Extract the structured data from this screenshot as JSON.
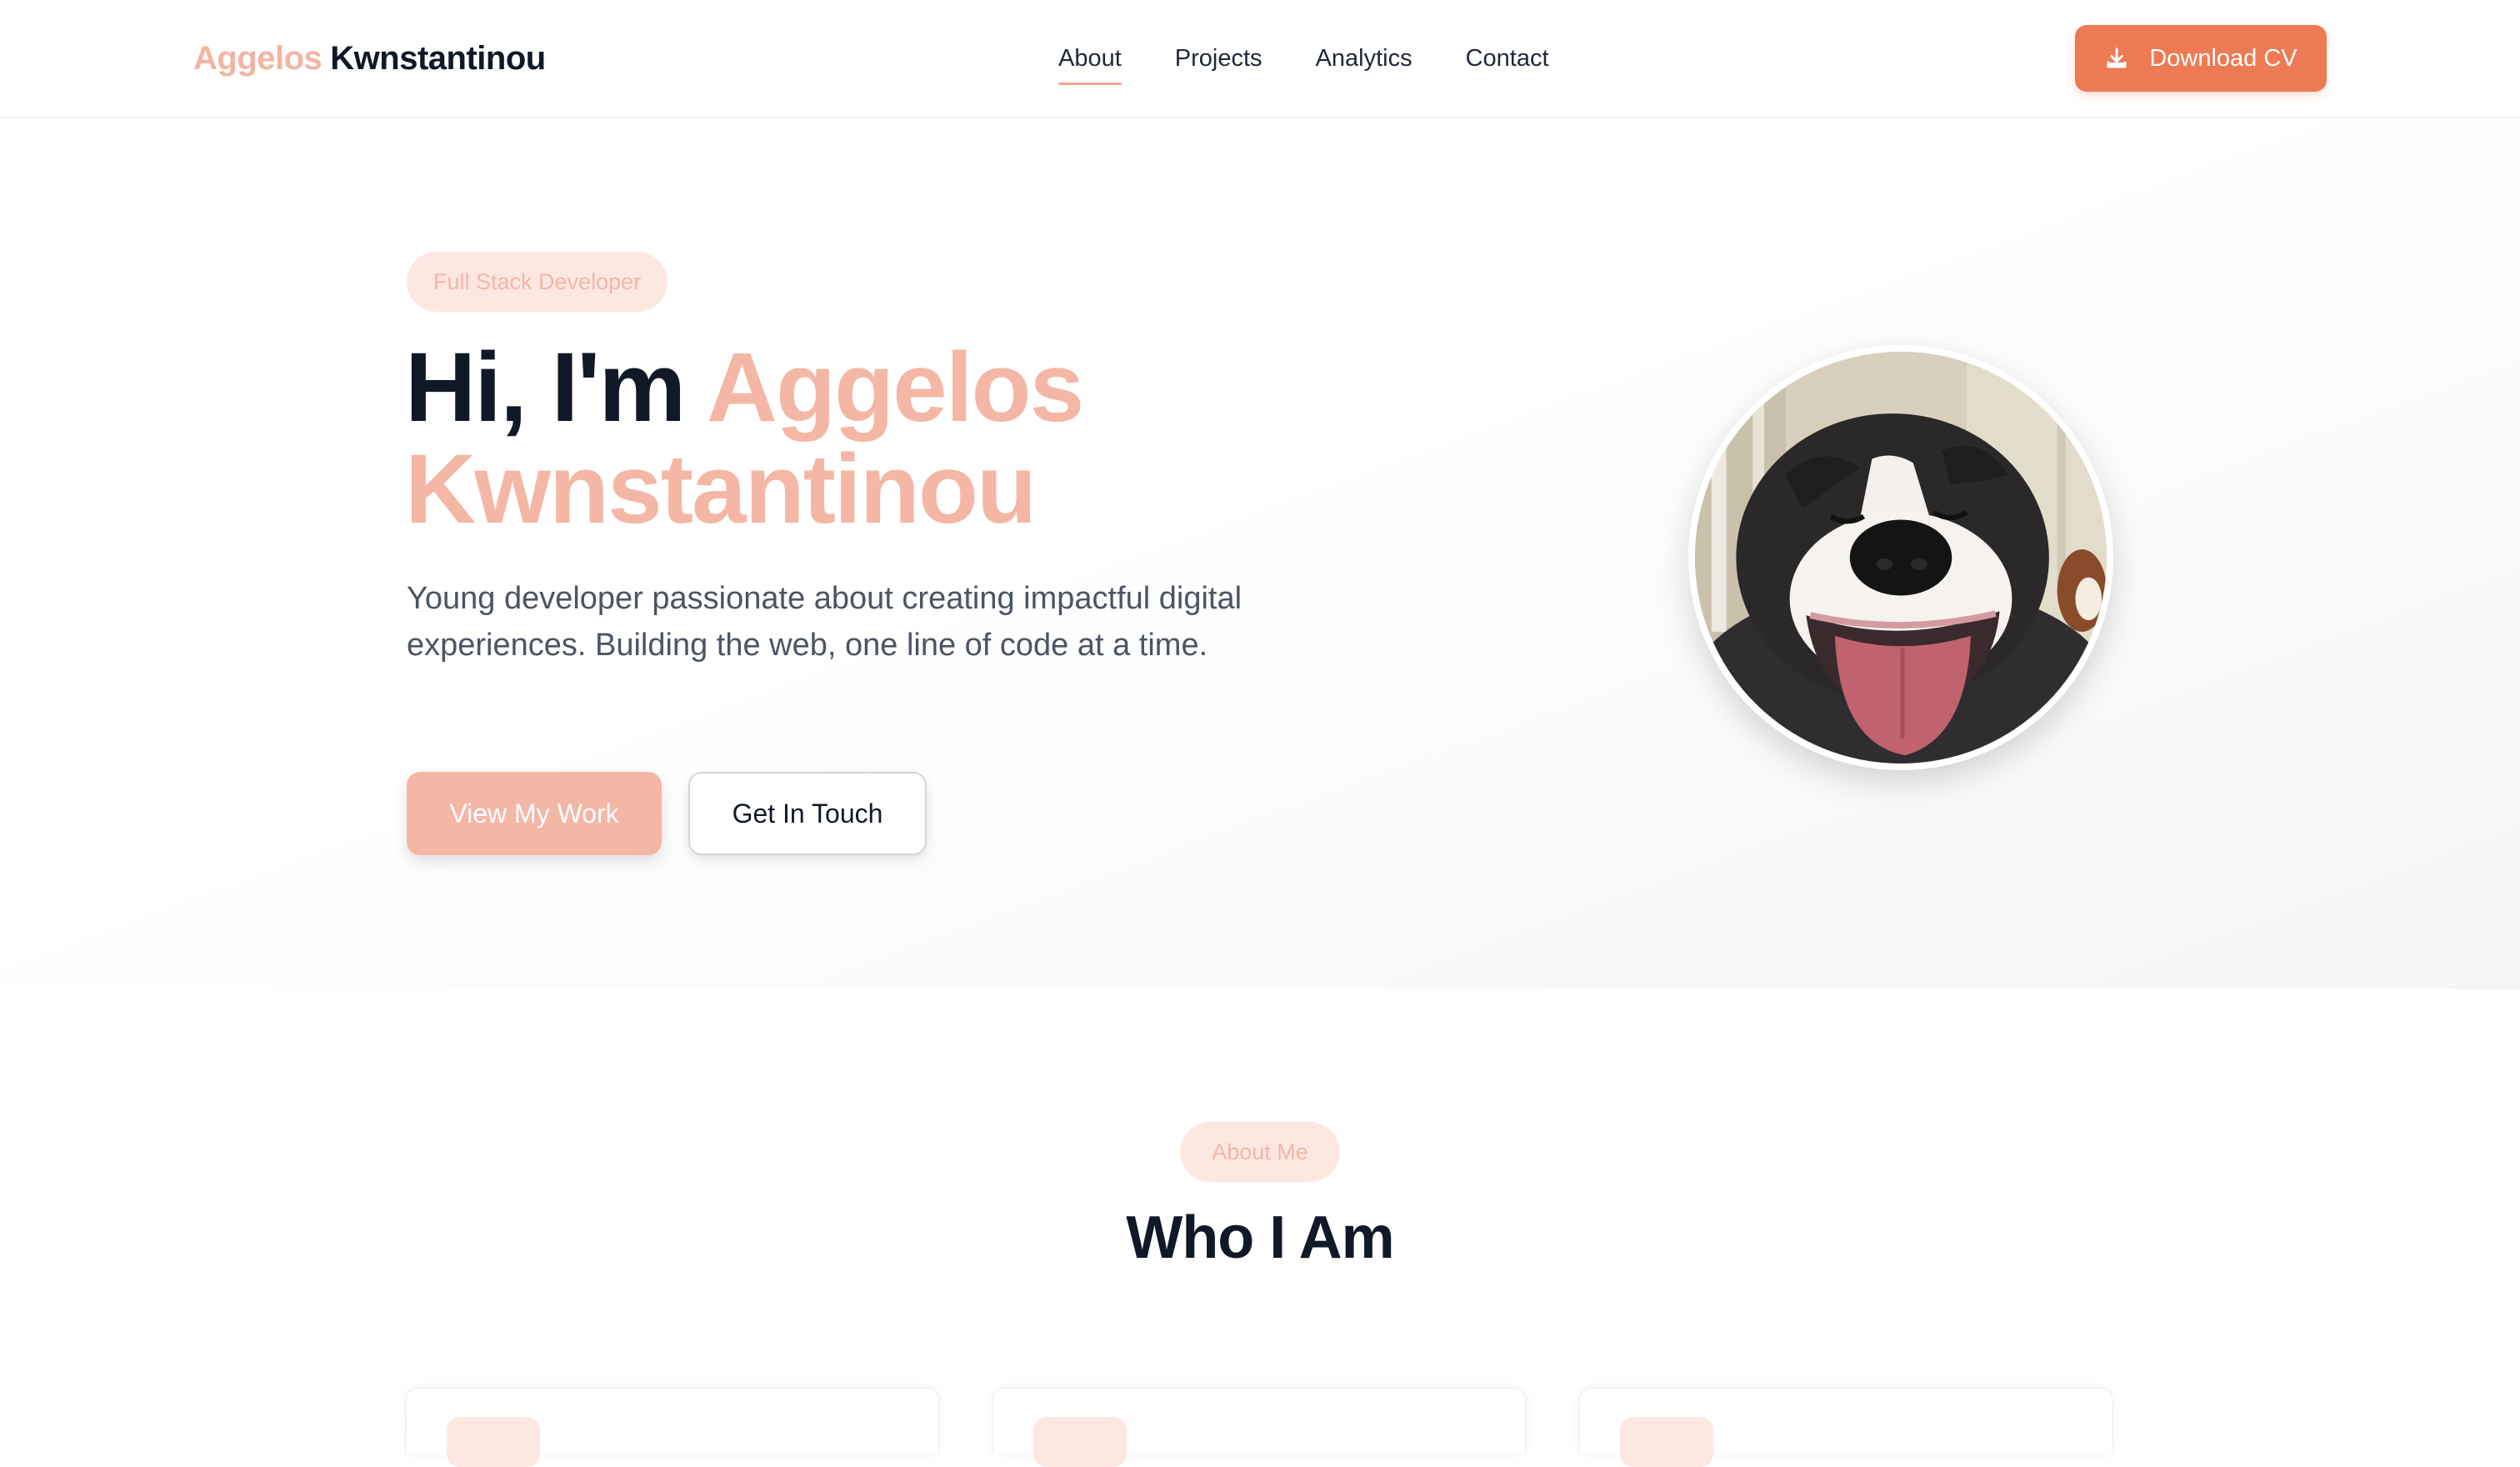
{
  "nav": {
    "logo_first": "Aggelos",
    "logo_last": "Kwnstantinou",
    "links": [
      "About",
      "Projects",
      "Analytics",
      "Contact"
    ],
    "active_link": "About",
    "download_label": "Download CV"
  },
  "hero": {
    "badge": "Full Stack Developer",
    "greeting": "Hi, I'm",
    "name": "Aggelos Kwnstantinou",
    "description": "Young developer passionate about creating impactful digital experiences. Building the web, one line of code at a time.",
    "primary_button": "View My Work",
    "secondary_button": "Get In Touch"
  },
  "about": {
    "badge": "About Me",
    "title": "Who I Am"
  },
  "colors": {
    "accent": "#ee7a53",
    "accent_light": "#f4b7a5",
    "badge_bg": "#fde7e1",
    "heading": "#111827",
    "body_text": "#4b5563"
  },
  "icons": {
    "download": "download-icon"
  }
}
